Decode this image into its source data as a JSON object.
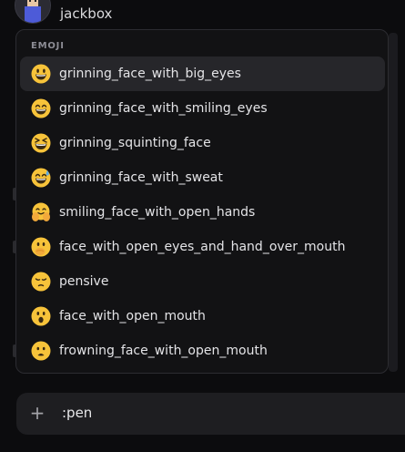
{
  "chat": {
    "username": "jackbox"
  },
  "emoji_popup": {
    "header": "EMOJI",
    "items": [
      {
        "label": "grinning_face_with_big_eyes",
        "icon": "grinning-face-with-big-eyes-icon",
        "selected": true
      },
      {
        "label": "grinning_face_with_smiling_eyes",
        "icon": "grinning-face-with-smiling-eyes-icon"
      },
      {
        "label": "grinning_squinting_face",
        "icon": "grinning-squinting-face-icon"
      },
      {
        "label": "grinning_face_with_sweat",
        "icon": "grinning-face-with-sweat-icon"
      },
      {
        "label": "smiling_face_with_open_hands",
        "icon": "smiling-face-with-open-hands-icon"
      },
      {
        "label": "face_with_open_eyes_and_hand_over_mouth",
        "icon": "face-with-open-eyes-and-hand-over-mouth-icon"
      },
      {
        "label": "pensive",
        "icon": "pensive-icon"
      },
      {
        "label": "face_with_open_mouth",
        "icon": "face-with-open-mouth-icon"
      },
      {
        "label": "frowning_face_with_open_mouth",
        "icon": "frowning-face-with-open-mouth-icon"
      }
    ]
  },
  "composer": {
    "add_icon": "plus-icon",
    "text": ":pen"
  },
  "colors": {
    "background": "#0c0c0e",
    "popup": "#121214",
    "selected_row": "#26262a",
    "emoji_yellow": "#f7c33a"
  }
}
